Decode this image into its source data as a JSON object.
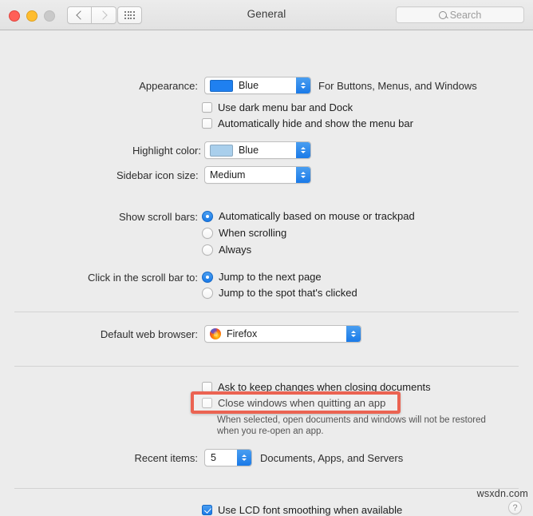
{
  "window": {
    "title": "General",
    "traffic_lights": [
      "close",
      "minimize",
      "zoom"
    ],
    "nav_back": "back",
    "nav_forward": "forward",
    "show_all": "show-all-grid"
  },
  "search": {
    "placeholder": "Search",
    "value": ""
  },
  "settings": {
    "appearance": {
      "label": "Appearance:",
      "value": "Blue",
      "swatch_color": "#1f80f0",
      "hint": "For Buttons, Menus, and Windows",
      "checkboxes": [
        {
          "label": "Use dark menu bar and Dock",
          "checked": false
        },
        {
          "label": "Automatically hide and show the menu bar",
          "checked": false
        }
      ]
    },
    "highlight_color": {
      "label": "Highlight color:",
      "value": "Blue",
      "swatch_color": "#a9cfec"
    },
    "sidebar_icon_size": {
      "label": "Sidebar icon size:",
      "value": "Medium"
    },
    "show_scroll_bars": {
      "label": "Show scroll bars:",
      "options": [
        {
          "label": "Automatically based on mouse or trackpad",
          "selected": true
        },
        {
          "label": "When scrolling",
          "selected": false
        },
        {
          "label": "Always",
          "selected": false
        }
      ]
    },
    "click_scroll_bar": {
      "label": "Click in the scroll bar to:",
      "options": [
        {
          "label": "Jump to the next page",
          "selected": true
        },
        {
          "label": "Jump to the spot that's clicked",
          "selected": false
        }
      ]
    },
    "default_web_browser": {
      "label": "Default web browser:",
      "value": "Firefox",
      "icon": "firefox-icon"
    },
    "documents": {
      "ask_keep_changes": {
        "label": "Ask to keep changes when closing documents",
        "checked": false
      },
      "close_windows": {
        "label": "Close windows when quitting an app",
        "checked": false
      },
      "close_windows_description_line1": "When selected, open documents and windows will not be restored",
      "close_windows_description_line2": "when you re-open an app.",
      "highlight_color": "#eb6352"
    },
    "recent_items": {
      "label": "Recent items:",
      "value": "5",
      "hint": "Documents, Apps, and Servers"
    },
    "font_smoothing": {
      "label": "Use LCD font smoothing when available",
      "checked": true
    }
  },
  "help": {
    "label": "?"
  },
  "watermark": {
    "text": "wsxdn.com"
  }
}
